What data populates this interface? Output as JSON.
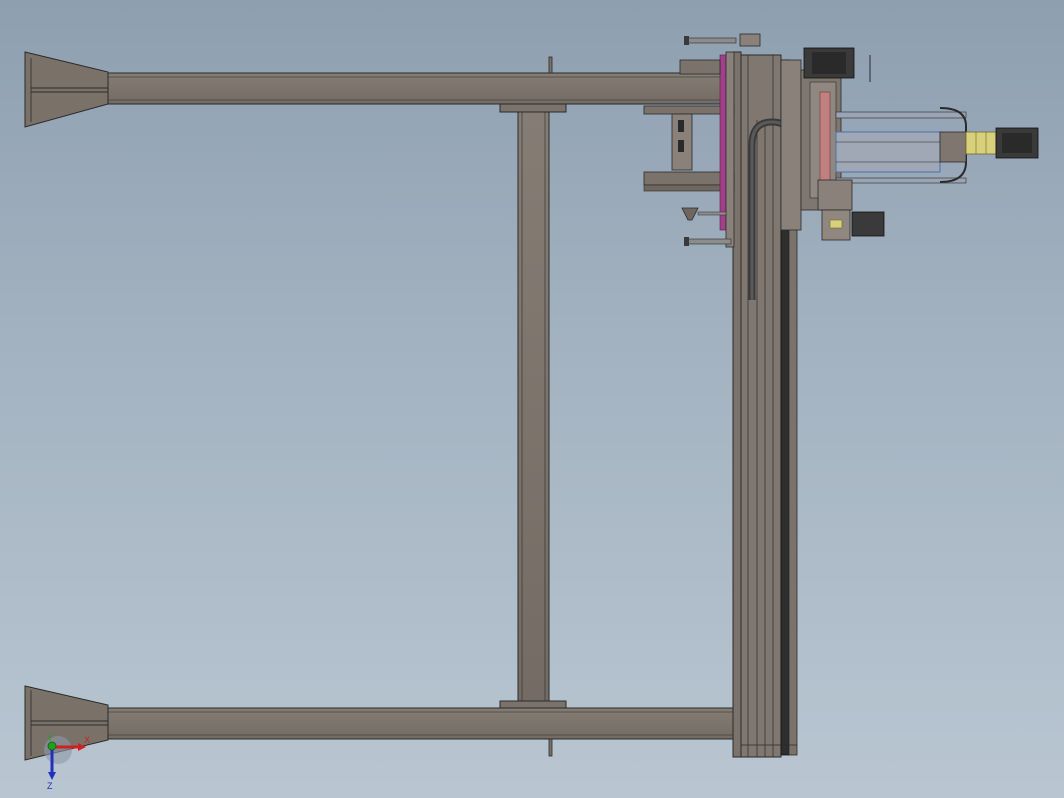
{
  "viewport": {
    "background_top": "#8e9fb0",
    "background_bottom": "#b9c6d2"
  },
  "model": {
    "frame_color": "#7b736b",
    "edge_color": "#2a2a2a",
    "accent_magenta": "#a0408a",
    "accent_blue": "#4a6fb0",
    "motor_color": "#3a3a3a",
    "coupling_color": "#d8d07a"
  },
  "triad": {
    "x_label": "X",
    "y_label": "Y",
    "z_label": "Z",
    "x_color": "#d02020",
    "y_color": "#20a020",
    "z_color": "#2030c0"
  }
}
